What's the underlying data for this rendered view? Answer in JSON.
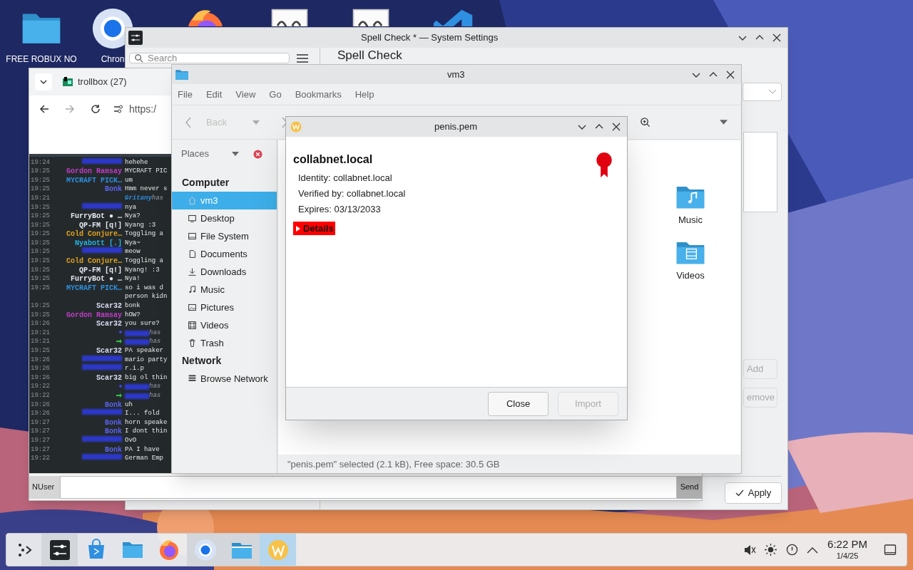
{
  "desktop_icons": [
    {
      "kind": "folder",
      "label": "FREE ROBUX NO"
    },
    {
      "kind": "chrome",
      "label": "Chron"
    },
    {
      "kind": "firefox"
    },
    {
      "kind": "document"
    },
    {
      "kind": "document"
    },
    {
      "kind": "code"
    }
  ],
  "settings_window": {
    "title": "Spell Check * — System Settings",
    "search": {
      "placeholder": "Search"
    },
    "heading": "Spell Check",
    "buttons": [
      {
        "label": "Add",
        "disabled": true
      },
      {
        "label": "emove",
        "disabled": true
      }
    ],
    "apply": "Apply"
  },
  "browser": {
    "tab_title": "trollbox (27)",
    "url": "https:/",
    "chat": [
      {
        "kind": "redacted",
        "time": "19:24",
        "text": "hehehe"
      },
      {
        "kind": "message",
        "time": "19:25",
        "name": "Gordon Ramsay",
        "color": "#c03cc8",
        "text": "MYCRAFT PIC"
      },
      {
        "kind": "message",
        "time": "19:25",
        "name": "MYCRAFT PICK…",
        "color": "#2f8fe0",
        "text": "um"
      },
      {
        "kind": "message",
        "time": "19:25",
        "name": "Bonk",
        "color": "#5a63f0",
        "text": "Hmm never s"
      },
      {
        "kind": "event",
        "time": "19:21",
        "name": "Gritany",
        "color": "#2f8fe0",
        "text": "has"
      },
      {
        "kind": "redacted",
        "time": "19:25",
        "text": "nya"
      },
      {
        "kind": "message",
        "time": "19:25",
        "name": "FurryBot ● …",
        "color": "#e6e6f0",
        "text": "Nya?"
      },
      {
        "kind": "message",
        "time": "19:25",
        "name": "QP-FM [q!]",
        "color": "#e6e6f0",
        "text": "Nyang :3"
      },
      {
        "kind": "message",
        "time": "19:25",
        "name": "Cold Conjure…",
        "color": "#e0a21e",
        "text": "Toggling a"
      },
      {
        "kind": "message",
        "time": "19:25",
        "name": "Nyabott [.]",
        "color": "#24b4e8",
        "text": "Nya~"
      },
      {
        "kind": "redacted",
        "time": "19:25",
        "text": "meow"
      },
      {
        "kind": "message",
        "time": "19:25",
        "name": "Cold Conjure…",
        "color": "#e0a21e",
        "text": "Toggling a"
      },
      {
        "kind": "message",
        "time": "19:25",
        "name": "QP-FM [q!]",
        "color": "#e6e6f0",
        "text": "Nyang! :3"
      },
      {
        "kind": "message",
        "time": "19:25",
        "name": "FurryBot ● …",
        "color": "#e6e6f0",
        "text": "Nya!"
      },
      {
        "kind": "message",
        "time": "19:25",
        "name": "MYCRAFT PICK…",
        "color": "#2f8fe0",
        "text": "so i was d"
      },
      {
        "kind": "continuation",
        "text": "person kidn"
      },
      {
        "kind": "message",
        "time": "19:25",
        "name": "Scar32",
        "color": "#dcdcf4",
        "text": "bonk"
      },
      {
        "kind": "message",
        "time": "19:25",
        "name": "Gordon Ramsay",
        "color": "#c03cc8",
        "text": "hOW?"
      },
      {
        "kind": "message",
        "time": "19:26",
        "name": "Scar32",
        "color": "#dcdcf4",
        "text": "you sure?"
      },
      {
        "kind": "event_dot",
        "time": "19:21",
        "color": "#3a46d8",
        "text": "has"
      },
      {
        "kind": "event_arrow",
        "time": "19:21",
        "color": "#2ec24a",
        "text": "has"
      },
      {
        "kind": "message",
        "time": "19:25",
        "name": "Scar32",
        "color": "#dcdcf4",
        "text": "PA speaker"
      },
      {
        "kind": "redacted",
        "time": "19:26",
        "text": "mario party"
      },
      {
        "kind": "redacted",
        "time": "19:26",
        "text": "r.i.p"
      },
      {
        "kind": "message",
        "time": "19:26",
        "name": "Scar32",
        "color": "#dcdcf4",
        "text": "big ol thin"
      },
      {
        "kind": "event_dot",
        "time": "19:22",
        "color": "#3a46d8",
        "text": "has"
      },
      {
        "kind": "event_arrow",
        "time": "19:22",
        "color": "#2ec24a",
        "text": "has"
      },
      {
        "kind": "message",
        "time": "19:26",
        "name": "Bonk",
        "color": "#5a63f0",
        "text": "uh"
      },
      {
        "kind": "redacted",
        "time": "19:26",
        "text": "I... fold"
      },
      {
        "kind": "message",
        "time": "19:27",
        "name": "Bonk",
        "color": "#5a63f0",
        "text": "horn speake"
      },
      {
        "kind": "message",
        "time": "19:27",
        "name": "Bonk",
        "color": "#5a63f0",
        "text": "I dont thin"
      },
      {
        "kind": "redacted",
        "time": "19:27",
        "text": "OvO"
      },
      {
        "kind": "message",
        "time": "19:27",
        "name": "Bonk",
        "color": "#5a63f0",
        "text": "PA I have"
      },
      {
        "kind": "redacted",
        "time": "19:22",
        "text": "German Emp"
      }
    ],
    "nick": "NUser",
    "send": "Send"
  },
  "file_manager": {
    "title": "vm3",
    "menu": [
      "File",
      "Edit",
      "View",
      "Go",
      "Bookmarks",
      "Help"
    ],
    "back": {
      "label": "Back",
      "disabled": true
    },
    "places_title": "Places",
    "places": [
      {
        "kind": "header",
        "label": "Computer"
      },
      {
        "kind": "item",
        "label": "vm3",
        "selected": true
      },
      {
        "kind": "item",
        "label": "Desktop",
        "selected": false
      },
      {
        "kind": "item",
        "label": "File System",
        "selected": false
      },
      {
        "kind": "item",
        "label": "Documents",
        "selected": false
      },
      {
        "kind": "item",
        "label": "Downloads",
        "selected": false
      },
      {
        "kind": "item",
        "label": "Music",
        "selected": false
      },
      {
        "kind": "item",
        "label": "Pictures",
        "selected": false
      },
      {
        "kind": "item",
        "label": "Videos",
        "selected": false
      },
      {
        "kind": "item",
        "label": "Trash",
        "selected": false
      },
      {
        "kind": "header",
        "label": "Network"
      },
      {
        "kind": "item",
        "label": "Browse Network",
        "selected": false
      }
    ],
    "files": [
      {
        "label": "Music"
      },
      {
        "label": "Videos"
      }
    ],
    "status": "\"penis.pem\" selected (2.1 kB), Free space: 30.5 GB"
  },
  "dialog": {
    "title": "penis.pem",
    "heading": "collabnet.local",
    "fields": [
      "Identity: collabnet.local",
      "Verified by: collabnet.local",
      "Expires: 03/13/2033"
    ],
    "details": {
      "label": "Details",
      "expanded": false
    },
    "buttons": [
      {
        "label": "Close",
        "disabled": false
      },
      {
        "label": "Import",
        "disabled": true
      }
    ]
  },
  "taskbar": {
    "tasks": [
      {
        "kind": "settings",
        "open": true,
        "selected": false
      },
      {
        "kind": "store",
        "open": false,
        "selected": false
      },
      {
        "kind": "folder",
        "open": false,
        "selected": false
      },
      {
        "kind": "firefox",
        "open": false,
        "selected": false
      },
      {
        "kind": "chrome",
        "open": true,
        "selected": false
      },
      {
        "kind": "filemanager",
        "open": true,
        "selected": false
      },
      {
        "kind": "w",
        "open": true,
        "selected": true
      }
    ],
    "time": "6:22 PM",
    "date": "1/4/25"
  }
}
